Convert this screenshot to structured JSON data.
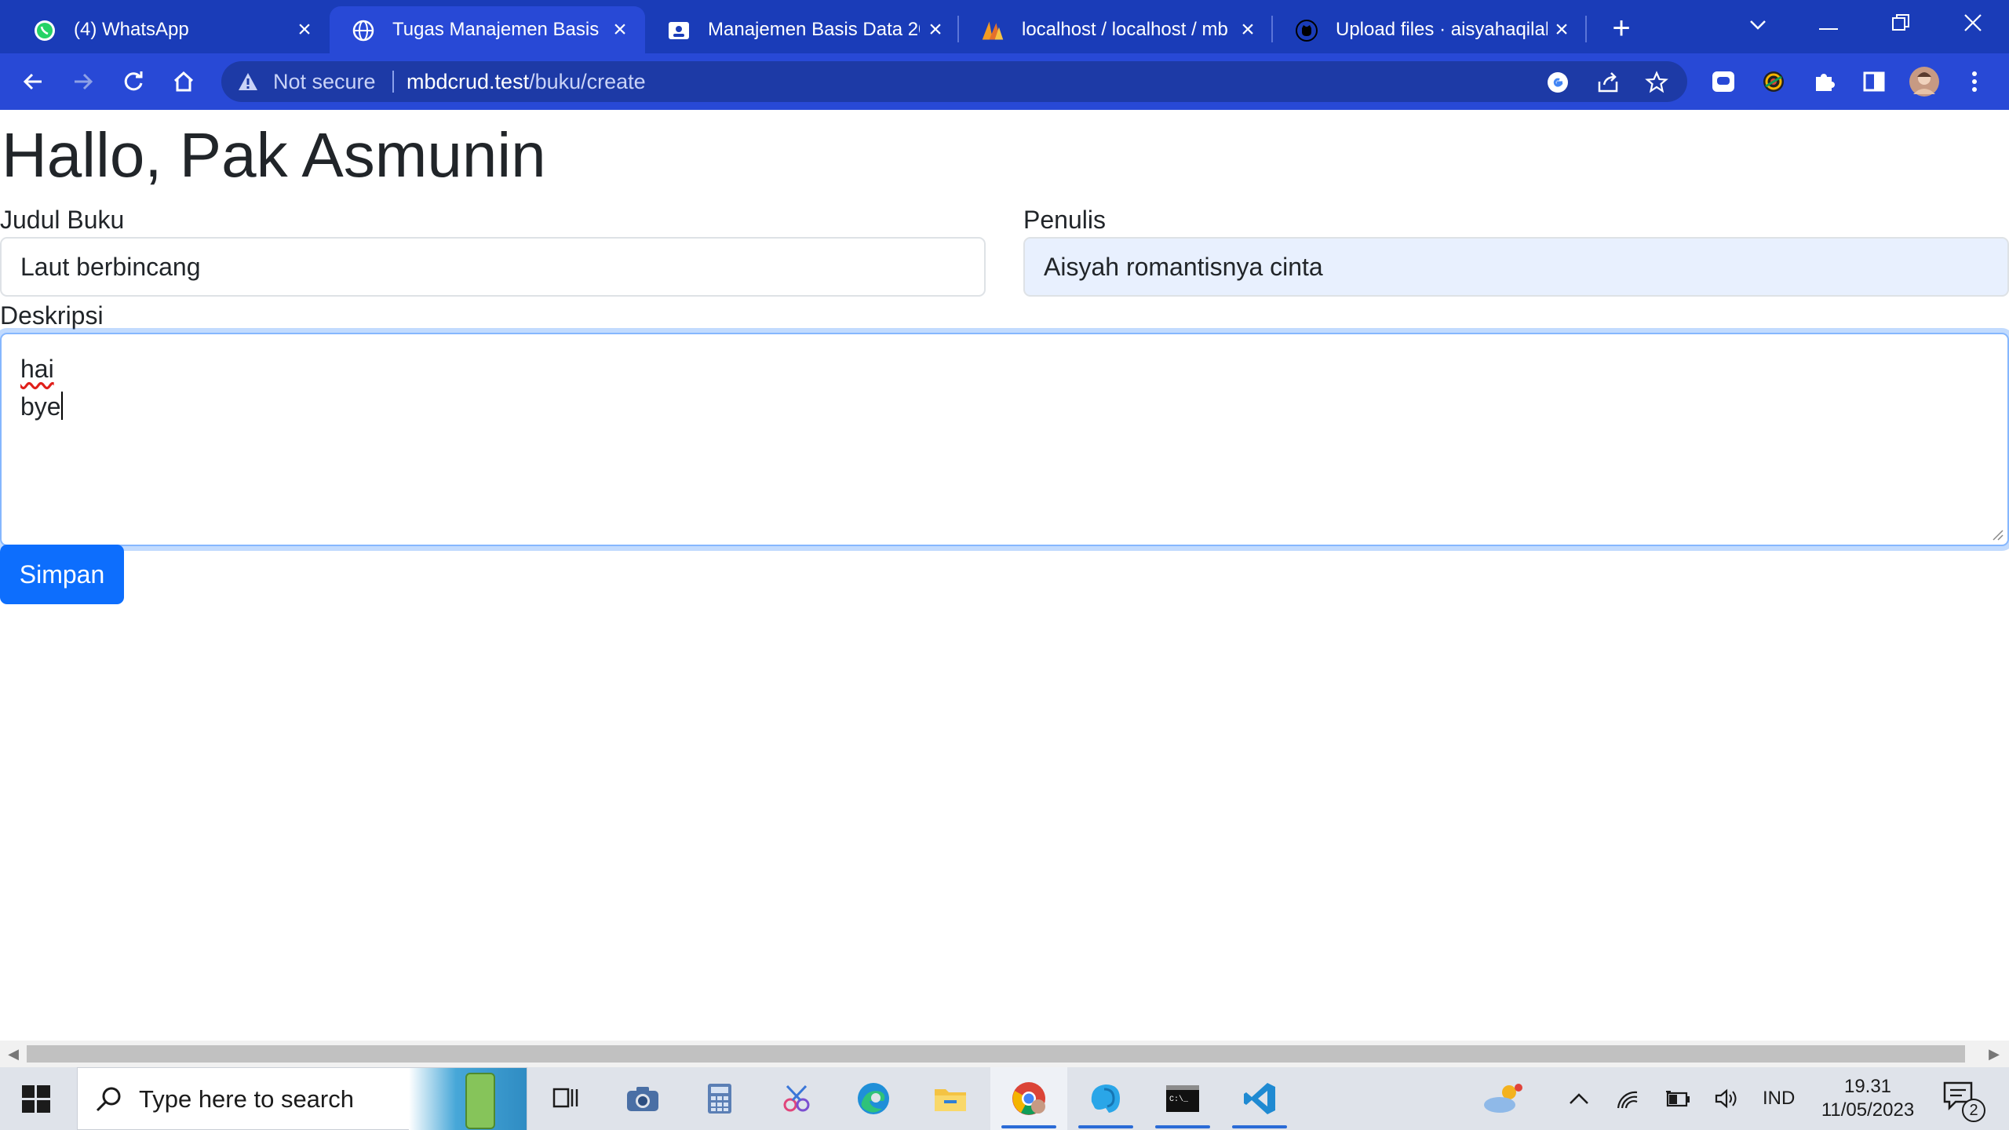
{
  "browser": {
    "tabs": [
      {
        "title": "(4) WhatsApp",
        "icon": "whatsapp-icon",
        "active": false
      },
      {
        "title": "Tugas Manajemen Basis D",
        "icon": "globe-icon",
        "active": true
      },
      {
        "title": "Manajemen Basis Data 20",
        "icon": "classroom-icon",
        "active": false
      },
      {
        "title": "localhost / localhost / mb",
        "icon": "phpmyadmin-icon",
        "active": false
      },
      {
        "title": "Upload files · aisyahaqilah",
        "icon": "github-icon",
        "active": false
      }
    ],
    "new_tab_label": "+",
    "omnibox": {
      "security_label": "Not secure",
      "url_host": "mbdcrud.test",
      "url_path": "/buku/create"
    }
  },
  "page": {
    "greeting": "Hallo, Pak Asmunin",
    "form": {
      "judul_label": "Judul Buku",
      "judul_value": "Laut berbincang",
      "penulis_label": "Penulis",
      "penulis_value": "Aisyah romantisnya cinta",
      "deskripsi_label": "Deskripsi",
      "deskripsi_lines": [
        "hai",
        "bye"
      ],
      "submit_label": "Simpan"
    }
  },
  "taskbar": {
    "search_placeholder": "Type here to search",
    "language": "IND",
    "time": "19.31",
    "date": "11/05/2023",
    "notification_count": "2"
  },
  "colors": {
    "chrome_tabstrip": "#1a3cb8",
    "chrome_toolbar": "#2849d6",
    "primary_button": "#0d6efd",
    "focus_border": "#86b7fe",
    "autofill_bg": "#e8f0fe"
  }
}
